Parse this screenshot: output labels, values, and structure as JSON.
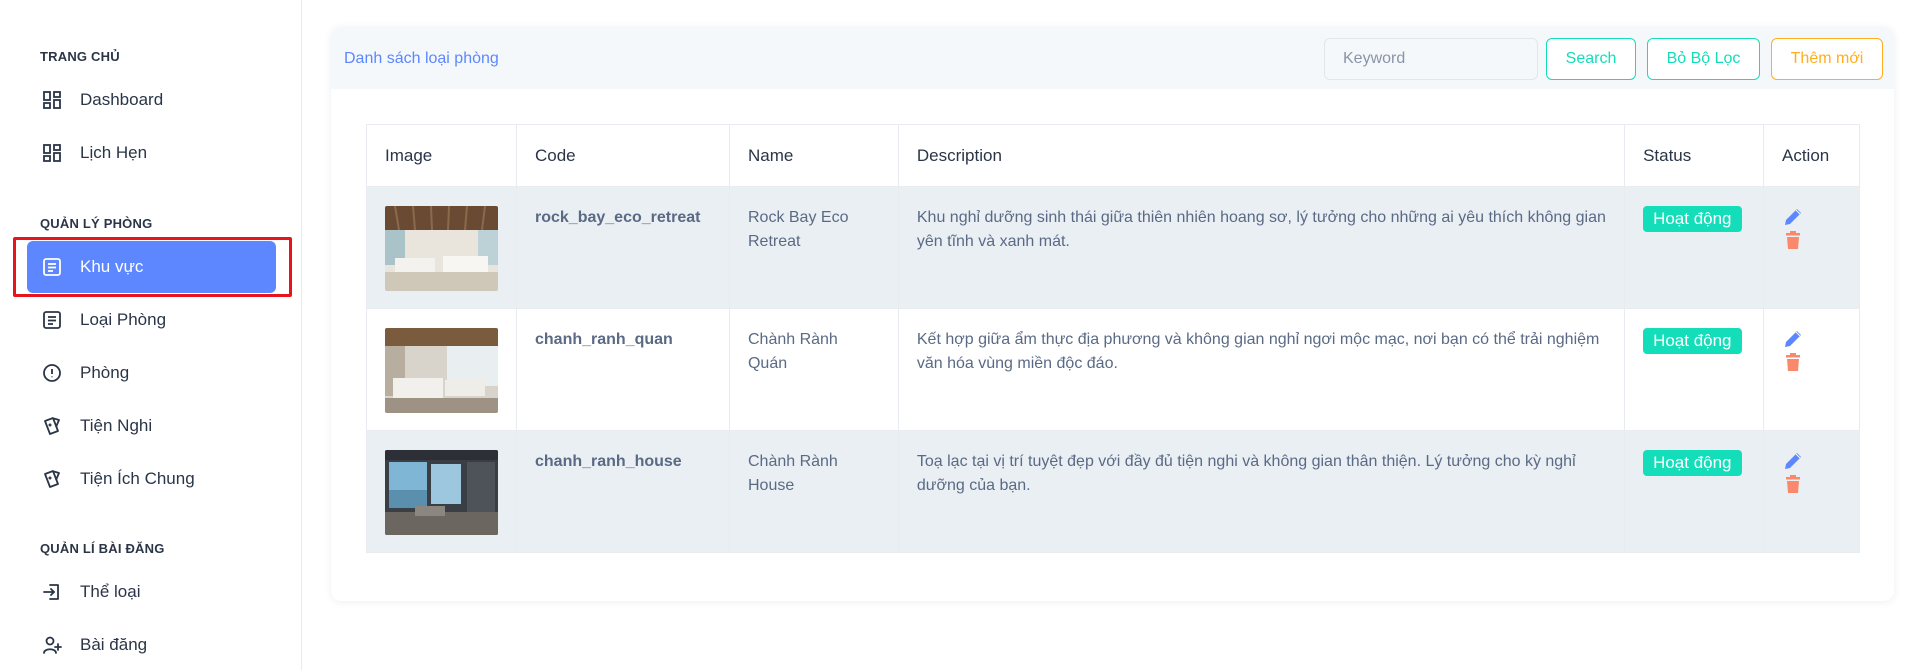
{
  "sidebar": {
    "sections": [
      {
        "title": "TRANG CHỦ"
      },
      {
        "title": "QUẢN LÝ PHÒNG"
      },
      {
        "title": "QUẢN LÍ BÀI ĐĂNG"
      }
    ],
    "items": [
      {
        "label": "Dashboard",
        "icon": "layout-dashboard-icon"
      },
      {
        "label": "Lịch Hẹn",
        "icon": "layout-dashboard-icon"
      },
      {
        "label": "Khu vực",
        "icon": "article-icon",
        "active": true
      },
      {
        "label": "Loại Phòng",
        "icon": "article-icon"
      },
      {
        "label": "Phòng",
        "icon": "alert-circle-icon"
      },
      {
        "label": "Tiện Nghi",
        "icon": "cards-icon"
      },
      {
        "label": "Tiện Ích Chung",
        "icon": "cards-icon"
      },
      {
        "label": "Thể loại",
        "icon": "login-icon"
      },
      {
        "label": "Bài đăng",
        "icon": "user-plus-icon"
      }
    ]
  },
  "card": {
    "title": "Danh sách loại phòng",
    "search_placeholder": "Keyword",
    "search_label": "Search",
    "clear_filter_label": "Bỏ Bộ Lọc",
    "add_label": "Thêm mới"
  },
  "table": {
    "headers": [
      "Image",
      "Code",
      "Name",
      "Description",
      "Status",
      "Action"
    ],
    "rows": [
      {
        "code": "rock_bay_eco_retreat",
        "name": "Rock Bay Eco Retreat",
        "description": "Khu nghỉ dưỡng sinh thái giữa thiên nhiên hoang sơ, lý tưởng cho những ai yêu thích không gian yên tĩnh và xanh mát.",
        "status": "Hoạt động"
      },
      {
        "code": "chanh_ranh_quan",
        "name": "Chành Rành Quán",
        "description": "Kết hợp giữa ẩm thực địa phương và không gian nghỉ ngơi mộc mạc, nơi bạn có thể trải nghiệm văn hóa vùng miền độc đáo.",
        "status": "Hoạt động"
      },
      {
        "code": "chanh_ranh_house",
        "name": "Chành Rành House",
        "description": "Toạ lạc tại vị trí tuyệt đẹp với đầy đủ tiện nghi và không gian thân thiện. Lý tưởng cho kỳ nghỉ dưỡng của bạn.",
        "status": "Hoạt động"
      }
    ]
  },
  "colors": {
    "primary": "#5d87ff",
    "success": "#13deb9",
    "warning": "#ffae1f",
    "danger": "#fa896b",
    "highlight_border": "#e8141c"
  }
}
